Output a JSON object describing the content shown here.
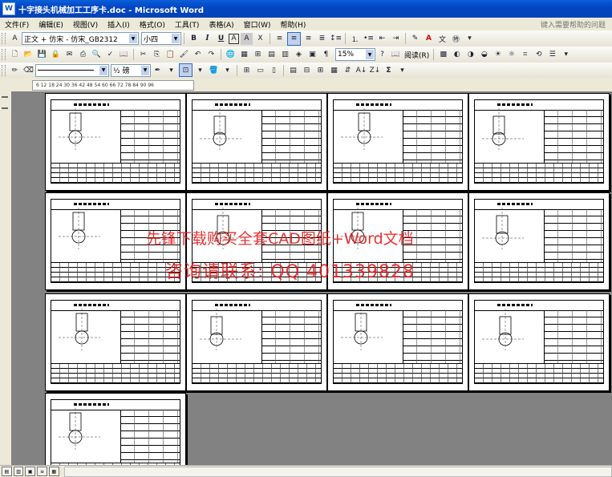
{
  "window": {
    "title": "十字接头机械加工工序卡.doc - Microsoft Word"
  },
  "menu": {
    "items": [
      "文件(F)",
      "编辑(E)",
      "视图(V)",
      "插入(I)",
      "格式(O)",
      "工具(T)",
      "表格(A)",
      "窗口(W)",
      "帮助(H)"
    ],
    "help_placeholder": "键入需要帮助的问题"
  },
  "format_toolbar": {
    "style": "正文 + 仿宋 - 仿宋_GB2312",
    "size": "小四",
    "bold": "B",
    "italic": "I",
    "underline": "U",
    "charbox": "A",
    "charscale": "X"
  },
  "standard_toolbar": {
    "zoom": "15%",
    "reading": "阅读(R)"
  },
  "drawing_toolbar": {
    "line_weight": "½ 磅",
    "sigma": "Σ"
  },
  "ruler": {
    "ticks": "6   12 18 24 30 36 42 48 54 60 66 72 78 84 90 96"
  },
  "watermark": {
    "line1": "先锋下载购买全套CAD图纸+Word文档",
    "line2": "咨询请联系: QQ 401339828"
  }
}
